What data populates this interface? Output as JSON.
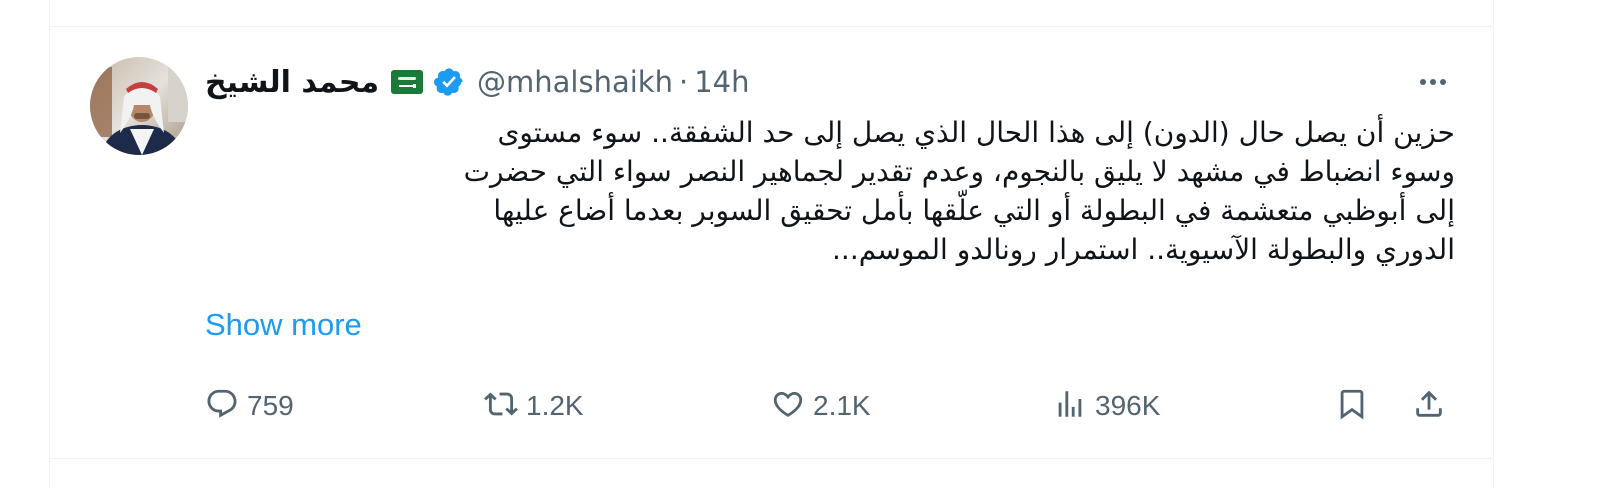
{
  "tweet": {
    "author": {
      "display_name": "محمد الشيخ",
      "handle": "@mhalshaikh",
      "flag_icon": "saudi-flag-icon",
      "verified_icon": "verified-badge-icon"
    },
    "separator": "·",
    "timestamp": "14h",
    "text_lines": [
      "حزين أن يصل حال (الدون) إلى هذا الحال الذي يصل إلى حد الشفقة.. سوء مستوى",
      "وسوء انضباط في مشهد لا يليق بالنجوم، وعدم تقدير لجماهير النصر سواء التي حضرت",
      "إلى أبوظبي متعشمة في البطولة أو التي علّقها بأمل تحقيق السوبر بعدما أضاع عليها",
      "الدوري والبطولة الآسيوية.. استمرار رونالدو الموسم..."
    ],
    "show_more_label": "Show more",
    "actions": {
      "reply": {
        "icon": "reply-icon",
        "count": "759"
      },
      "retweet": {
        "icon": "retweet-icon",
        "count": "1.2K"
      },
      "like": {
        "icon": "heart-icon",
        "count": "2.1K"
      },
      "views": {
        "icon": "views-icon",
        "count": "396K"
      },
      "bookmark": {
        "icon": "bookmark-icon"
      },
      "share": {
        "icon": "share-icon"
      }
    },
    "more_icon": "more-options-icon"
  },
  "colors": {
    "accent": "#1d9bf0",
    "text_primary": "#0f1419",
    "text_secondary": "#536471",
    "divider": "#eff3f4"
  }
}
